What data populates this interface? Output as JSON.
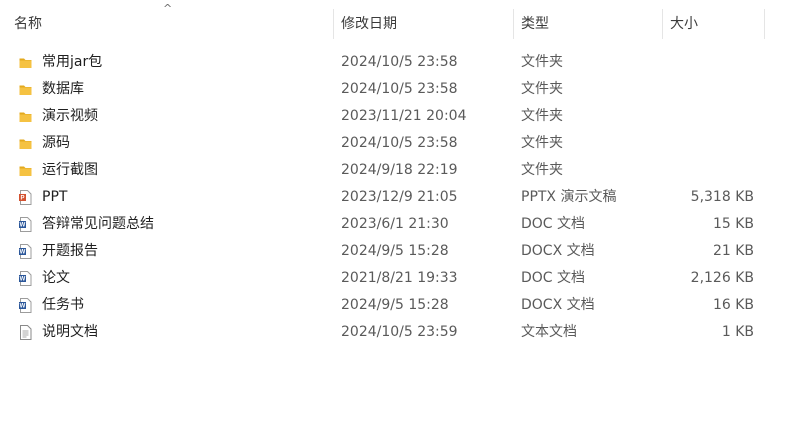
{
  "columns": {
    "name": "名称",
    "date": "修改日期",
    "type": "类型",
    "size": "大小"
  },
  "files": [
    {
      "name": "常用jar包",
      "date": "2024/10/5 23:58",
      "type": "文件夹",
      "size": "",
      "icon": "folder-icon"
    },
    {
      "name": "数据库",
      "date": "2024/10/5 23:58",
      "type": "文件夹",
      "size": "",
      "icon": "folder-icon"
    },
    {
      "name": "演示视频",
      "date": "2023/11/21 20:04",
      "type": "文件夹",
      "size": "",
      "icon": "folder-icon"
    },
    {
      "name": "源码",
      "date": "2024/10/5 23:58",
      "type": "文件夹",
      "size": "",
      "icon": "folder-icon"
    },
    {
      "name": "运行截图",
      "date": "2024/9/18 22:19",
      "type": "文件夹",
      "size": "",
      "icon": "folder-icon"
    },
    {
      "name": "PPT",
      "date": "2023/12/9 21:05",
      "type": "PPTX 演示文稿",
      "size": "5,318 KB",
      "icon": "powerpoint-icon"
    },
    {
      "name": "答辩常见问题总结",
      "date": "2023/6/1 21:30",
      "type": "DOC 文档",
      "size": "15 KB",
      "icon": "word-document-icon"
    },
    {
      "name": "开题报告",
      "date": "2024/9/5 15:28",
      "type": "DOCX 文档",
      "size": "21 KB",
      "icon": "word-document-icon"
    },
    {
      "name": "论文",
      "date": "2021/8/21 19:33",
      "type": "DOC 文档",
      "size": "2,126 KB",
      "icon": "word-document-icon"
    },
    {
      "name": "任务书",
      "date": "2024/9/5 15:28",
      "type": "DOCX 文档",
      "size": "16 KB",
      "icon": "word-document-icon"
    },
    {
      "name": "说明文档",
      "date": "2024/10/5 23:59",
      "type": "文本文档",
      "size": "1 KB",
      "icon": "text-document-icon"
    }
  ],
  "colors": {
    "folder": "#f5c242",
    "folder_dark": "#e3a91e",
    "powerpoint": "#d35230",
    "word": "#2b579a",
    "text_doc": "#8a8a8a"
  }
}
